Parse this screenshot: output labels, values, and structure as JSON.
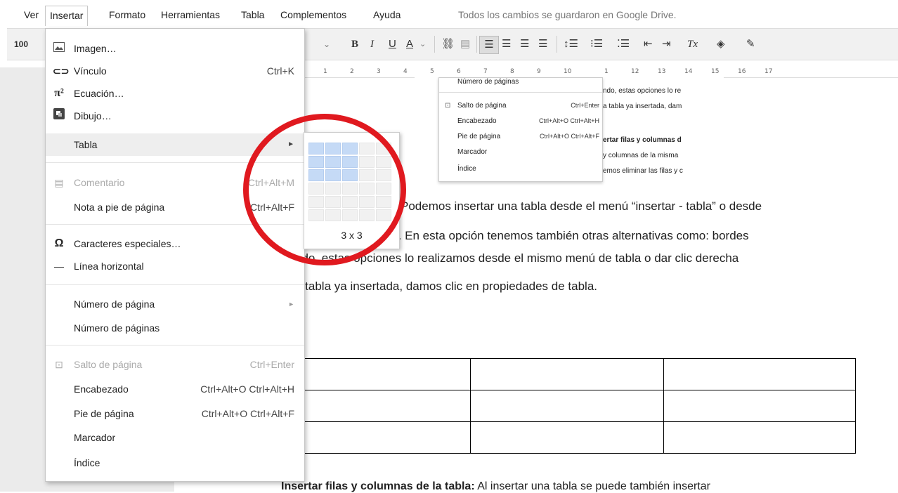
{
  "menubar": {
    "items": [
      "Ver",
      "Insertar",
      "Formato",
      "Herramientas",
      "Tabla",
      "Complementos",
      "Ayuda"
    ],
    "save_status": "Todos los cambios se guardaron en Google Drive."
  },
  "toolbar": {
    "zoom": "100",
    "bold": "B",
    "italic": "I",
    "underline": "U",
    "text_color": "A",
    "clear_format": "Tx"
  },
  "ruler": {
    "ticks": [
      "1",
      "2",
      "3",
      "4",
      "5",
      "6",
      "7",
      "8",
      "9",
      "10",
      "1",
      "12",
      "13",
      "14",
      "15",
      "16",
      "17"
    ]
  },
  "insert_menu": {
    "items": [
      {
        "label": "Imagen…",
        "shortcut": "",
        "icon": "image-icon"
      },
      {
        "label": "Vínculo",
        "shortcut": "Ctrl+K",
        "icon": "link-icon"
      },
      {
        "label": "Ecuación…",
        "shortcut": "",
        "icon": "pi-icon"
      },
      {
        "label": "Dibujo…",
        "shortcut": "",
        "icon": "drawing-icon"
      },
      {
        "label": "Tabla",
        "shortcut": "",
        "icon": ""
      },
      {
        "label": "Comentario",
        "shortcut": "Ctrl+Alt+M",
        "icon": "comment-icon"
      },
      {
        "label": "Nota a pie de página",
        "shortcut": "Ctrl+Alt+F",
        "icon": ""
      },
      {
        "label": "Caracteres especiales…",
        "shortcut": "",
        "icon": "omega-icon"
      },
      {
        "label": "Línea horizontal",
        "shortcut": "",
        "icon": "dash-icon"
      },
      {
        "label": "Número de página",
        "shortcut": "",
        "icon": ""
      },
      {
        "label": "Número de páginas",
        "shortcut": "",
        "icon": ""
      },
      {
        "label": "Salto de página",
        "shortcut": "Ctrl+Enter",
        "icon": "page-break-icon"
      },
      {
        "label": "Encabezado",
        "shortcut": "Ctrl+Alt+O Ctrl+Alt+H",
        "icon": ""
      },
      {
        "label": "Pie de página",
        "shortcut": "Ctrl+Alt+O Ctrl+Alt+F",
        "icon": ""
      },
      {
        "label": "Marcador",
        "shortcut": "",
        "icon": ""
      },
      {
        "label": "Índice",
        "shortcut": "",
        "icon": ""
      }
    ]
  },
  "table_grid": {
    "label": "3 x 3",
    "selected_rows": 3,
    "selected_cols": 3
  },
  "inner_menu": {
    "items": [
      {
        "label": "Número de páginas",
        "shortcut": ""
      },
      {
        "label": "Salto de página",
        "shortcut": "Ctrl+Enter"
      },
      {
        "label": "Encabezado",
        "shortcut": "Ctrl+Alt+O Ctrl+Alt+H"
      },
      {
        "label": "Pie de página",
        "shortcut": "Ctrl+Alt+O Ctrl+Alt+F"
      },
      {
        "label": "Marcador",
        "shortcut": ""
      },
      {
        "label": "Índice",
        "shortcut": ""
      }
    ],
    "side_lines": [
      "ndo, estas opciones lo re",
      "a tabla ya insertada, dam",
      "ertar filas y columnas d",
      "y columnas de la misma",
      "emos eliminar las filas y c"
    ]
  },
  "document": {
    "line1": "Podemos insertar una tabla desde el menú “insertar - tabla” o desde",
    "line2": "bla. En esta opción tenemos también otras alternativas como: bordes",
    "line3": "ndo, estas opciones lo realizamos desde el mismo menú de tabla o dar clic derecha",
    "line4": "a tabla ya insertada, damos clic en propiedades de tabla.",
    "bottom_bold": "Insertar filas y columnas de la tabla:",
    "bottom_rest": " Al insertar una tabla se puede también insertar"
  },
  "colors": {
    "annotation": "#e0191f",
    "grid_selected": "#c5daf6",
    "menu_highlight": "#eeeeee"
  }
}
